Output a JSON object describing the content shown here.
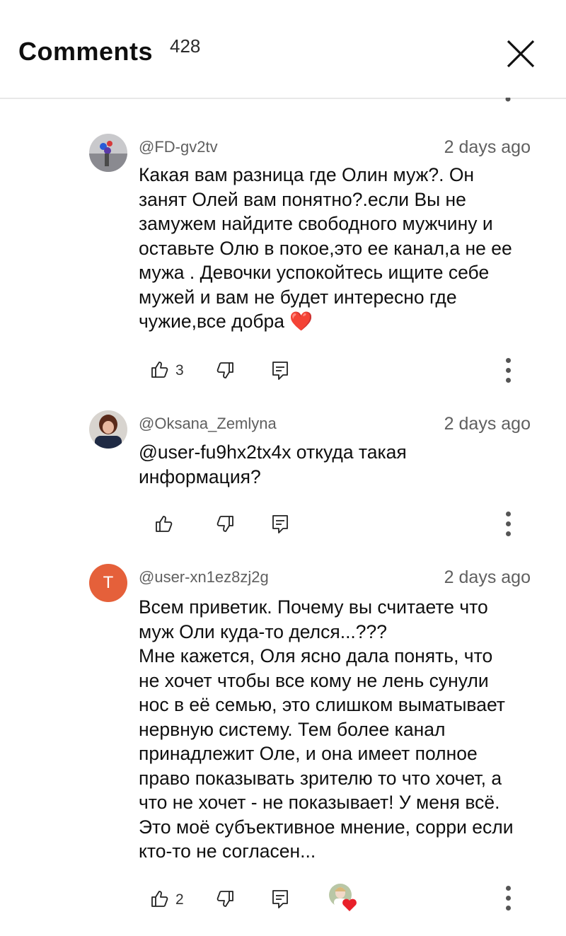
{
  "header": {
    "title": "Comments",
    "count": "428"
  },
  "comments": [
    {
      "author": "@FD-gv2tv",
      "time": "2 days ago",
      "text": "Какая вам разница где Олин муж?. Он\nзанят Олей вам понятно?.если Вы не\nзамужем найдите свободного мужчину и\nоставьте Олю в покое,это ее канал,а не ее\nмужа . Девочки успокойтесь ищите себе\nмужей и вам не будет интересно где\nчужие,все добра",
      "emoji": "❤️",
      "likes": "3"
    },
    {
      "author": "@Oksana_Zemlyna",
      "time": "2 days ago",
      "text": " @user-fu9hx2tx4x откуда такая\nинформация?",
      "likes": ""
    },
    {
      "author": "@user-xn1ez8zj2g",
      "avatar_letter": "T",
      "time": "2 days ago",
      "text": "Всем приветик. Почему вы считаете что\nмуж Оли куда-то делся...???\nМне кажется, Оля ясно дала понять, что\nне хочет чтобы все кому не лень сунули\nнос в её семью, это слишком выматывает\nнервную систему. Тем более канал\nпринадлежит Оле, и она имеет полное\nправо показывать зрителю то что хочет, а\nчто не хочет - не показывает! У меня всё.\nЭто моё субъективное мнение, сорри если\nкто-то не согласен...",
      "likes": "2"
    }
  ],
  "colors": {
    "avatar_letter_bg": "#e5603a",
    "creator_heart": "#e8202a"
  },
  "icons": [
    "close-icon",
    "like-icon",
    "dislike-icon",
    "reply-icon",
    "more-icon",
    "creator-heart-icon"
  ]
}
